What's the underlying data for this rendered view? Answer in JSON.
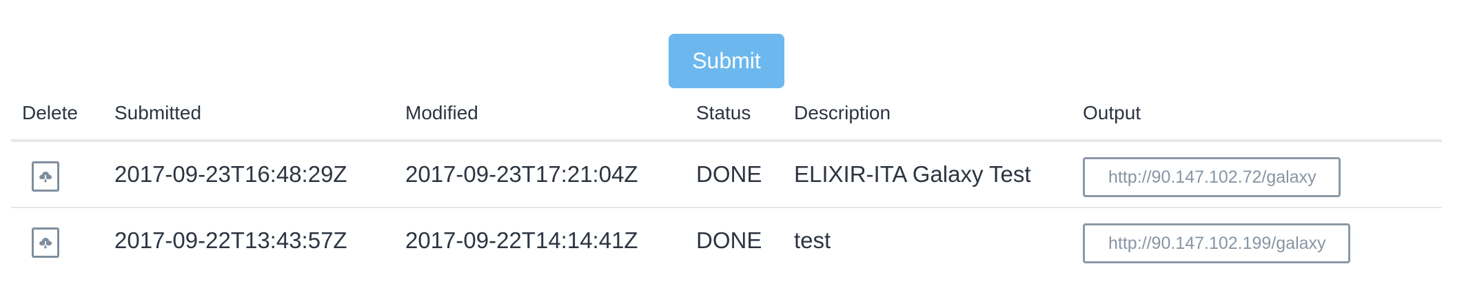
{
  "actions": {
    "submit_label": "Submit"
  },
  "table": {
    "headers": {
      "delete": "Delete",
      "submitted": "Submitted",
      "modified": "Modified",
      "status": "Status",
      "description": "Description",
      "output": "Output"
    },
    "rows": [
      {
        "delete_icon": "cloud-download-icon",
        "submitted": "2017-09-23T16:48:29Z",
        "modified": "2017-09-23T17:21:04Z",
        "status": "DONE",
        "description": "ELIXIR-ITA Galaxy Test",
        "output": "http://90.147.102.72/galaxy"
      },
      {
        "delete_icon": "cloud-download-icon",
        "submitted": "2017-09-22T13:43:57Z",
        "modified": "2017-09-22T14:14:41Z",
        "status": "DONE",
        "description": "test",
        "output": "http://90.147.102.199/galaxy"
      }
    ]
  },
  "colors": {
    "submit_button": "#6cb8ee",
    "text": "#2c3440",
    "output_border": "#8a98a7",
    "output_text": "#8795a4",
    "row_divider": "#e5e7ea"
  }
}
